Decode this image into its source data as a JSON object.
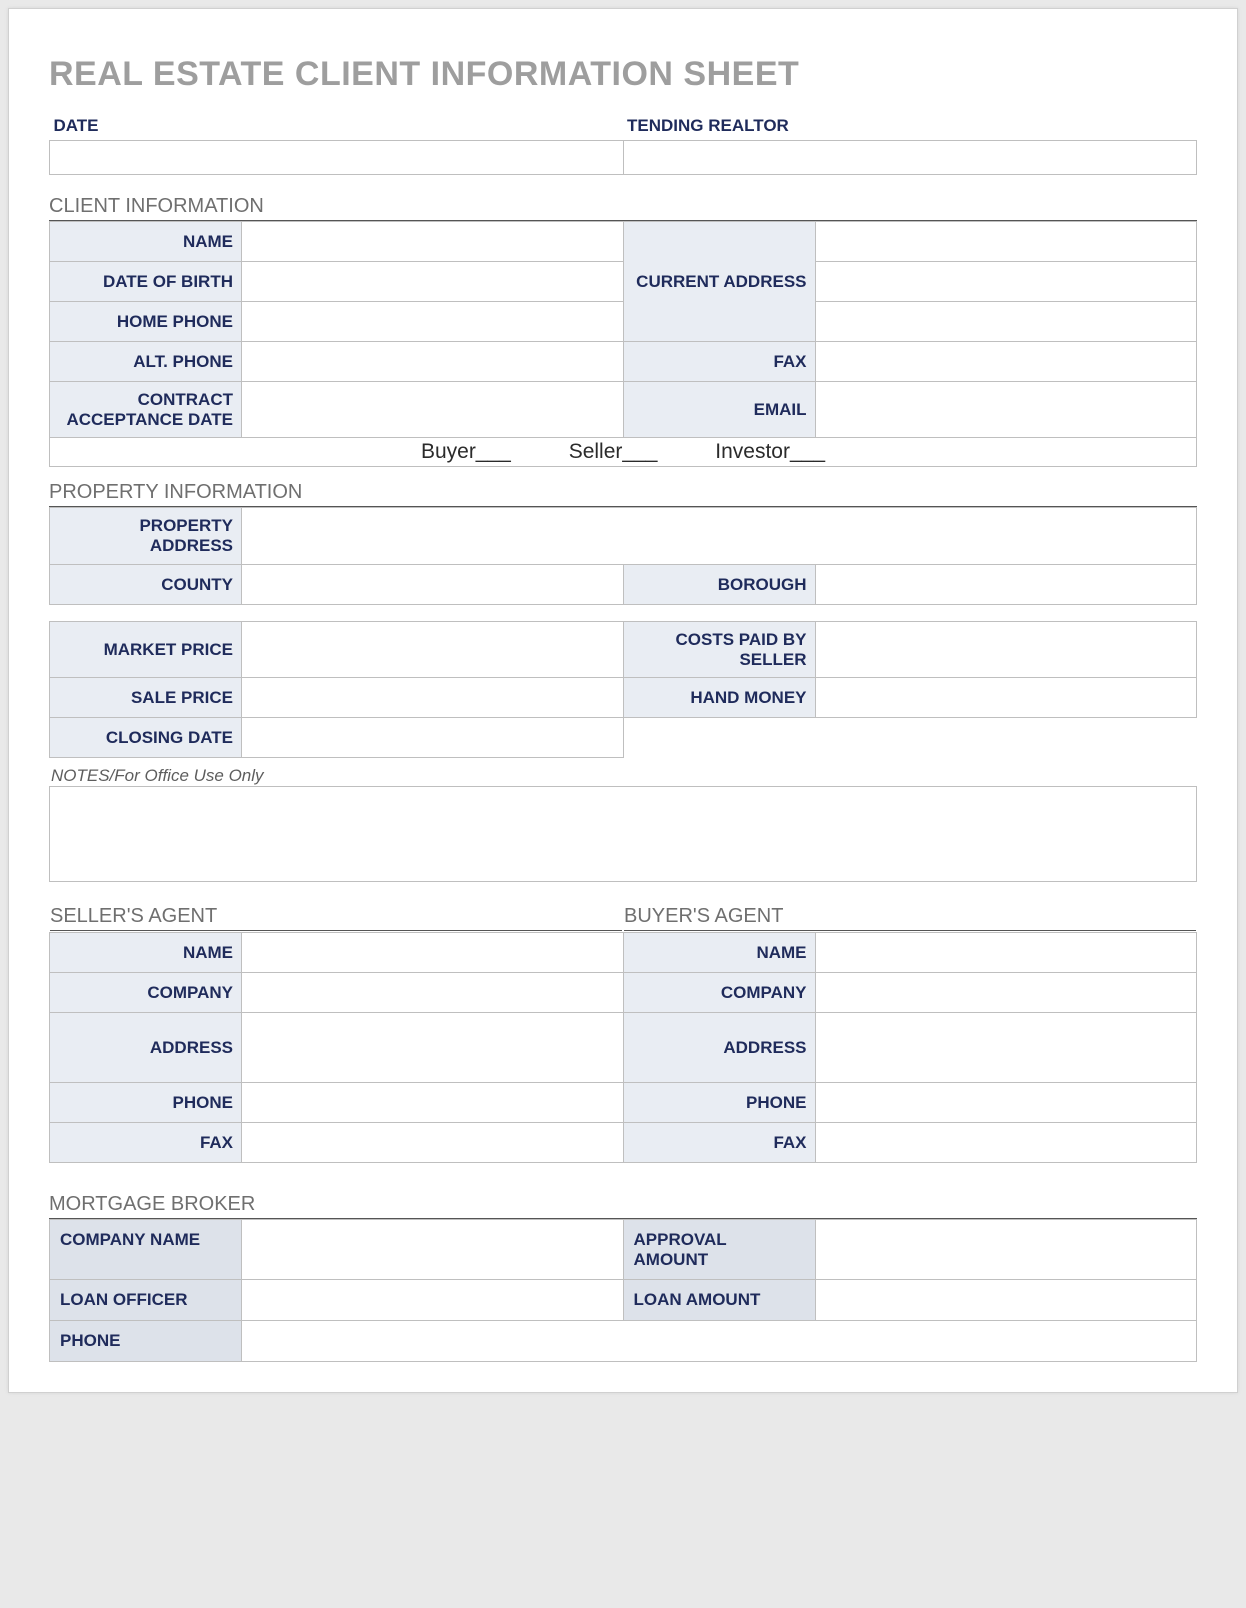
{
  "title": "REAL ESTATE CLIENT INFORMATION SHEET",
  "top": {
    "date_label": "DATE",
    "date_value": "",
    "realtor_label": "TENDING REALTOR",
    "realtor_value": ""
  },
  "client": {
    "heading": "CLIENT INFORMATION",
    "name_label": "NAME",
    "name_value": "",
    "dob_label": "DATE OF BIRTH",
    "dob_value": "",
    "home_phone_label": "HOME PHONE",
    "home_phone_value": "",
    "alt_phone_label": "ALT. PHONE",
    "alt_phone_value": "",
    "contract_date_label": "CONTRACT ACCEPTANCE DATE",
    "contract_date_value": "",
    "current_address_label": "CURRENT ADDRESS",
    "current_address_value1": "",
    "current_address_value2": "",
    "current_address_value3": "",
    "fax_label": "FAX",
    "fax_value": "",
    "email_label": "EMAIL",
    "email_value": "",
    "role_buyer": "Buyer___",
    "role_seller": "Seller___",
    "role_investor": "Investor___"
  },
  "property": {
    "heading": "PROPERTY INFORMATION",
    "address_label": "PROPERTY ADDRESS",
    "address_value": "",
    "county_label": "COUNTY",
    "county_value": "",
    "borough_label": "BOROUGH",
    "borough_value": "",
    "market_price_label": "MARKET PRICE",
    "market_price_value": "",
    "costs_by_seller_label": "COSTS PAID BY SELLER",
    "costs_by_seller_value": "",
    "sale_price_label": "SALE PRICE",
    "sale_price_value": "",
    "hand_money_label": "HAND MONEY",
    "hand_money_value": "",
    "closing_date_label": "CLOSING DATE",
    "closing_date_value": ""
  },
  "notes": {
    "label": "NOTES/For Office Use Only",
    "value": ""
  },
  "seller_agent": {
    "heading": "SELLER'S AGENT",
    "name_label": "NAME",
    "name_value": "",
    "company_label": "COMPANY",
    "company_value": "",
    "address_label": "ADDRESS",
    "address_value": "",
    "phone_label": "PHONE",
    "phone_value": "",
    "fax_label": "FAX",
    "fax_value": ""
  },
  "buyer_agent": {
    "heading": "BUYER'S AGENT",
    "name_label": "NAME",
    "name_value": "",
    "company_label": "COMPANY",
    "company_value": "",
    "address_label": "ADDRESS",
    "address_value": "",
    "phone_label": "PHONE",
    "phone_value": "",
    "fax_label": "FAX",
    "fax_value": ""
  },
  "broker": {
    "heading": "MORTGAGE BROKER",
    "company_name_label": "COMPANY NAME",
    "company_name_value": "",
    "approval_amount_label": "APPROVAL AMOUNT",
    "approval_amount_value": "",
    "loan_officer_label": "LOAN OFFICER",
    "loan_officer_value": "",
    "loan_amount_label": "LOAN AMOUNT",
    "loan_amount_value": "",
    "phone_label": "PHONE",
    "phone_value": ""
  }
}
